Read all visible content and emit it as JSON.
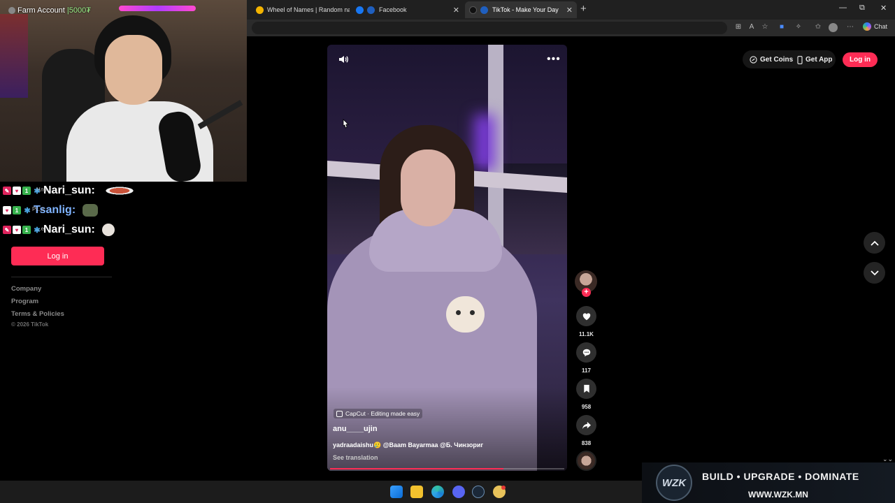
{
  "browser": {
    "tabs": [
      {
        "label": "Wheel of Names | Random name",
        "color": "#f4b400",
        "active": false
      },
      {
        "label": "Facebook",
        "color": "#1877f2",
        "active": false
      },
      {
        "label": "TikTok - Make Your Day",
        "color": "#111111",
        "active": true
      }
    ],
    "new_tab": "+",
    "toolbar": {
      "chat_label": "Chat"
    },
    "window_controls": {
      "minimize": "—",
      "maximize": "⧉",
      "close": "✕"
    }
  },
  "stream_overlay": {
    "title": "Farm Account",
    "amount": "|5000₮",
    "chat": [
      {
        "user": "Nari_sun:",
        "color": "#ffffff",
        "ghost": "Нлo"
      },
      {
        "user": "Tsanlig:",
        "color": "#7fb3ff",
        "ghost": "Pr...t"
      },
      {
        "user": "Nari_sun:",
        "color": "#ffffff",
        "ghost": "...e"
      }
    ],
    "badges": {
      "one": "1"
    }
  },
  "left_nav": {
    "login_label": "Log in",
    "links": [
      "Company",
      "Program",
      "Terms & Policies"
    ],
    "copyright": "© 2026 TikTok"
  },
  "header": {
    "get_coins": "Get Coins",
    "get_app": "Get App",
    "login": "Log in"
  },
  "video": {
    "more_icon": "•••",
    "effect_label": "CapCut · Editing made easy",
    "username": "anu____ujin",
    "caption": "yadraadaishu🥲 @Baam Bayarmaa @Б. Чинзориг",
    "see_translation": "See translation",
    "progress": 0.74
  },
  "actions": {
    "likes": "11.1K",
    "comments": "117",
    "saves": "958",
    "shares": "838",
    "follow": "+"
  },
  "sponsor": {
    "logo_text": "WZK",
    "tagline": "BUILD • UPGRADE • DOMINATE",
    "url": "WWW.WZK.MN"
  },
  "colors": {
    "accent": "#fe2c55",
    "background": "#000000"
  }
}
